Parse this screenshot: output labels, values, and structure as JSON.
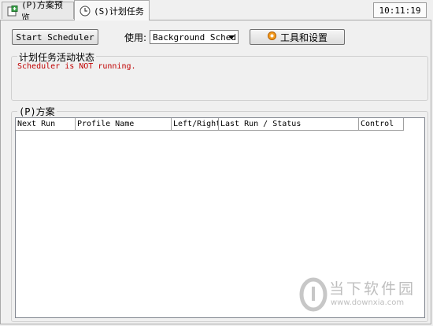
{
  "tabs": [
    {
      "label": "(P)方案预览",
      "icon": "profile-preview-icon"
    },
    {
      "label": "(S)计划任务",
      "icon": "clock-icon"
    }
  ],
  "clock": "10:11:19",
  "toolbar": {
    "start_label": "Start Scheduler",
    "use_label": "使用:",
    "use_value": "Background Sched",
    "tools_label": "工具和设置",
    "tools_icon": "gear-icon"
  },
  "activity": {
    "title": "计划任务活动状态",
    "status": "Scheduler is NOT running.",
    "status_color": "#c00000"
  },
  "profiles": {
    "title": "(P)方案",
    "columns": [
      "Next Run",
      "Profile Name",
      "Left/Right Fold",
      "Last Run / Status",
      "Control"
    ]
  },
  "watermark": {
    "title": "当下软件园",
    "url": "www.downxia.com"
  }
}
